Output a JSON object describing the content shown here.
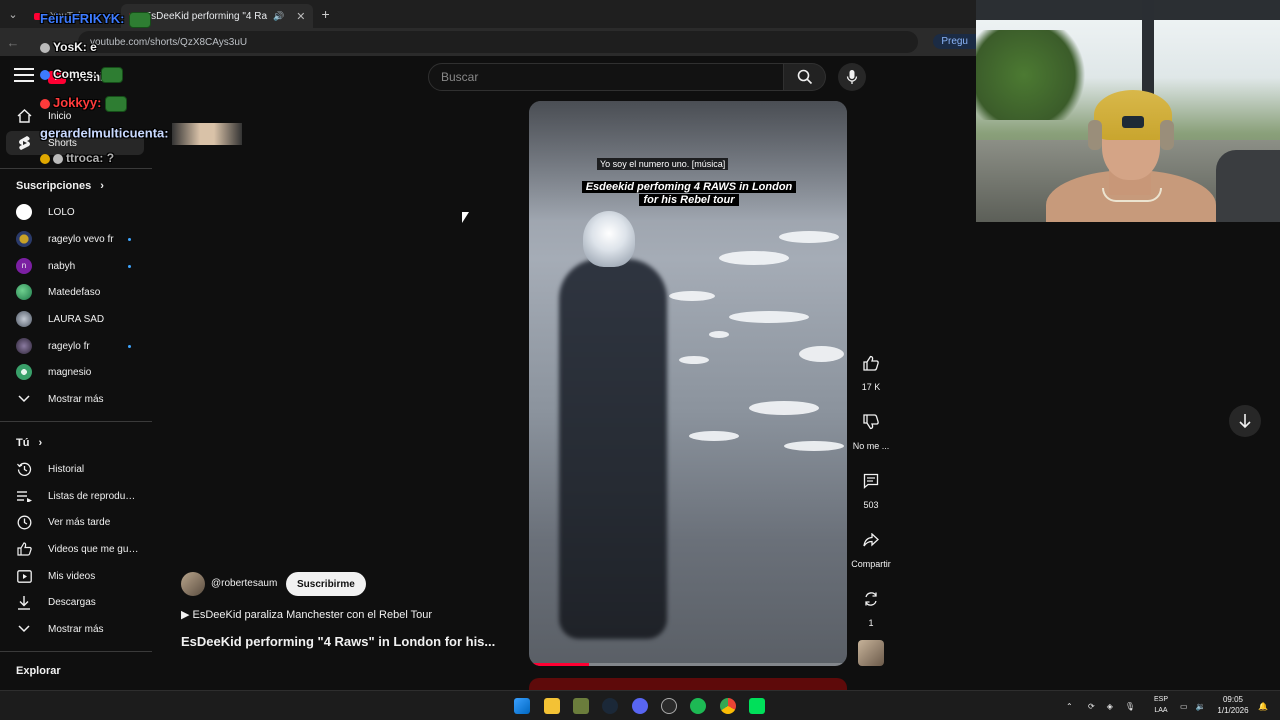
{
  "browser": {
    "tabs": [
      {
        "label": "YouTube",
        "active": false
      },
      {
        "label": "EsDeeKid performing \"4 Ra",
        "active": true
      }
    ],
    "url": "youtube.com/shorts/QzX8CAys3uU",
    "ask_button": "Pregu"
  },
  "header": {
    "logo_text": "Premium",
    "search_placeholder": "Buscar"
  },
  "sidebar": {
    "main": [
      {
        "label": "Inicio",
        "icon": "home-icon"
      },
      {
        "label": "Shorts",
        "icon": "shorts-icon",
        "selected": true
      }
    ],
    "subscriptions_heading": "Suscripciones",
    "subscriptions": [
      {
        "label": "LOLO",
        "color": "#ffffff",
        "dot": false
      },
      {
        "label": "rageylo vevo fr",
        "color": "#c9a227",
        "dot": true
      },
      {
        "label": "nabyh",
        "color": "#7b1fa2",
        "dot": true,
        "initial": "n"
      },
      {
        "label": "Matedefaso",
        "color": "#2e9e5b",
        "dot": false
      },
      {
        "label": "LAURA SAD",
        "color": "#6d7a8c",
        "dot": false
      },
      {
        "label": "rageylo fr",
        "color": "#4a3b5c",
        "dot": true
      },
      {
        "label": "magnesio",
        "color": "#39a06a",
        "dot": false
      }
    ],
    "show_more": "Mostrar más",
    "you_heading": "Tú",
    "you_items": [
      {
        "label": "Historial",
        "icon": "history-icon"
      },
      {
        "label": "Listas de reproducc...",
        "icon": "playlist-icon"
      },
      {
        "label": "Ver más tarde",
        "icon": "watch-later-icon"
      },
      {
        "label": "Videos que me gus...",
        "icon": "like-icon"
      },
      {
        "label": "Mis videos",
        "icon": "my-videos-icon"
      },
      {
        "label": "Descargas",
        "icon": "download-icon"
      }
    ],
    "show_more_2": "Mostrar más",
    "explore_heading": "Explorar"
  },
  "chat_overlay": [
    {
      "user": "FeiruFRIKYK:",
      "color": "#3d7bff"
    },
    {
      "user": "YosK:",
      "text": "e",
      "color": "#ffffff"
    },
    {
      "user": "Comes:",
      "color": "#ffffff"
    },
    {
      "user": "Jokkyy:",
      "color": "#ff3b3b"
    },
    {
      "user": "gerardelmulticuenta:",
      "color": "#c9d9ff"
    },
    {
      "user": "ttroca:",
      "text": "?",
      "color": "#b0b0b0"
    }
  ],
  "short": {
    "caption_small": "Yo soy el numero uno. [música]",
    "caption_big_1": "Esdeekid perfoming 4 RAWS in London",
    "caption_big_2": "for his Rebel tour",
    "progress": 0.19,
    "channel": "@robertesaum",
    "subscribe_label": "Suscribirme",
    "playlist_line": "EsDeeKid paraliza Manchester con el Rebel Tour",
    "title": "EsDeeKid performing \"4 Raws\" in London for his..."
  },
  "actions": {
    "like_count": "17 K",
    "dislike_label": "No me ...",
    "comments_count": "503",
    "share_label": "Compartir",
    "remix_count": "1"
  },
  "taskbar": {
    "lang_1": "ESP",
    "lang_2": "LAA",
    "time": "09:05",
    "date": "1/1/2026"
  }
}
